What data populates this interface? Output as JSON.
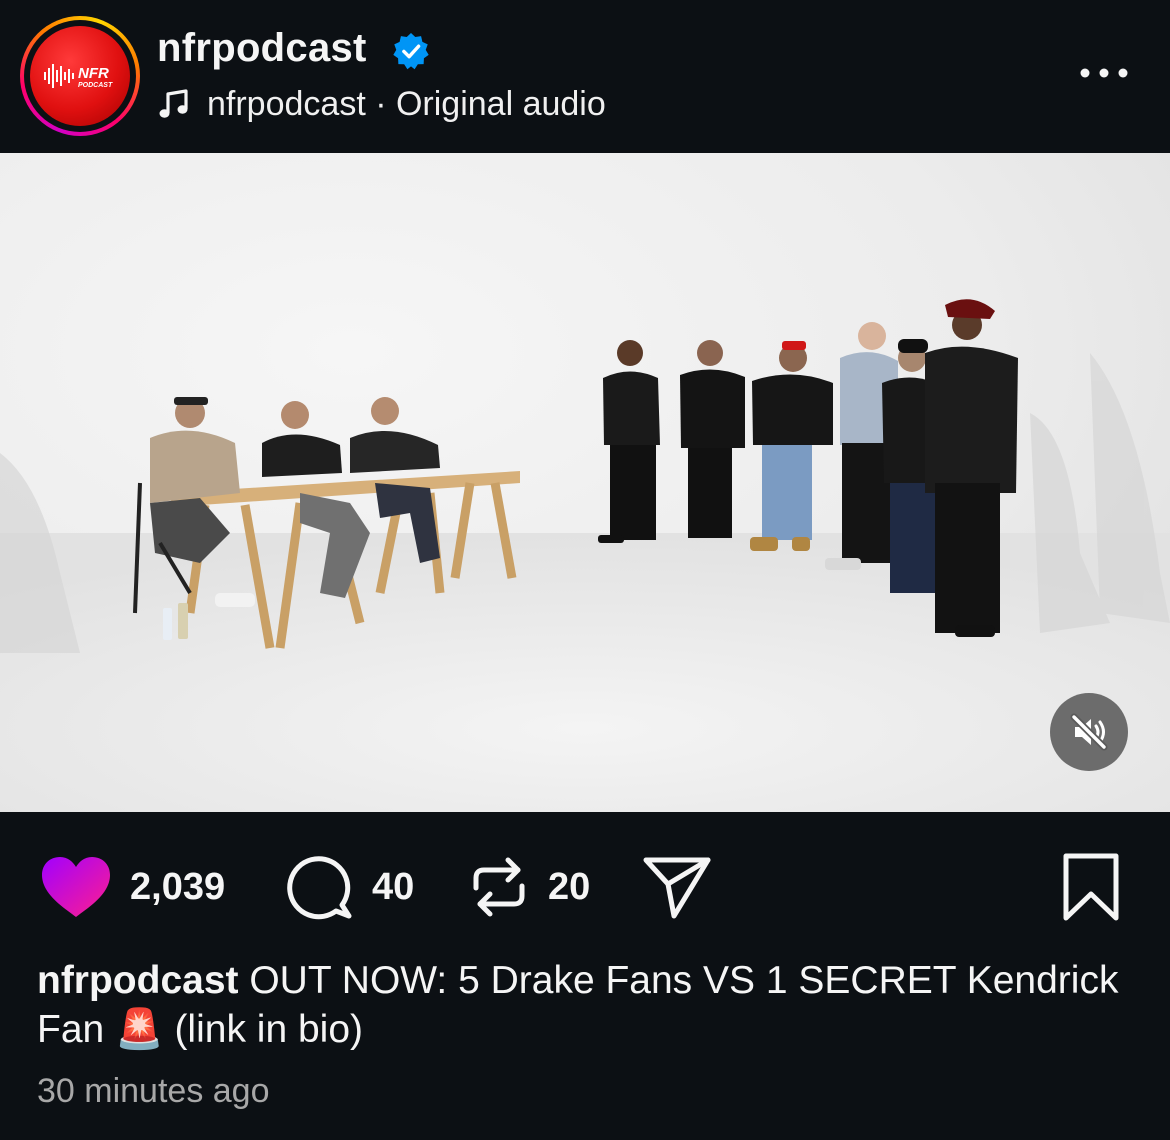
{
  "header": {
    "avatar_text": "NFR PODCAST",
    "username": "nfrpodcast",
    "verified_icon": "verified-badge-icon",
    "audio_label": "nfrpodcast · Original audio",
    "music_icon": "music-note-icon",
    "more_icon": "more-options-icon"
  },
  "media": {
    "mute_icon": "speaker-muted-icon"
  },
  "actions": {
    "like_count": "2,039",
    "comment_count": "40",
    "repost_count": "20",
    "like_color": "#d300c5",
    "icons": [
      "heart-icon",
      "comment-icon",
      "repost-icon",
      "share-icon",
      "bookmark-icon"
    ]
  },
  "caption": {
    "username": "nfrpodcast",
    "text_main": " OUT NOW: 5 Drake Fans VS 1 SECRET Kendrick Fan ",
    "emoji": "🚨",
    "text_end": " (link in bio)"
  },
  "timestamp": "30 minutes ago",
  "colors": {
    "background": "#0c1014",
    "verified": "#0095f6",
    "avatar_red": "#e01010",
    "secondary_text": "#a8a8a8"
  }
}
